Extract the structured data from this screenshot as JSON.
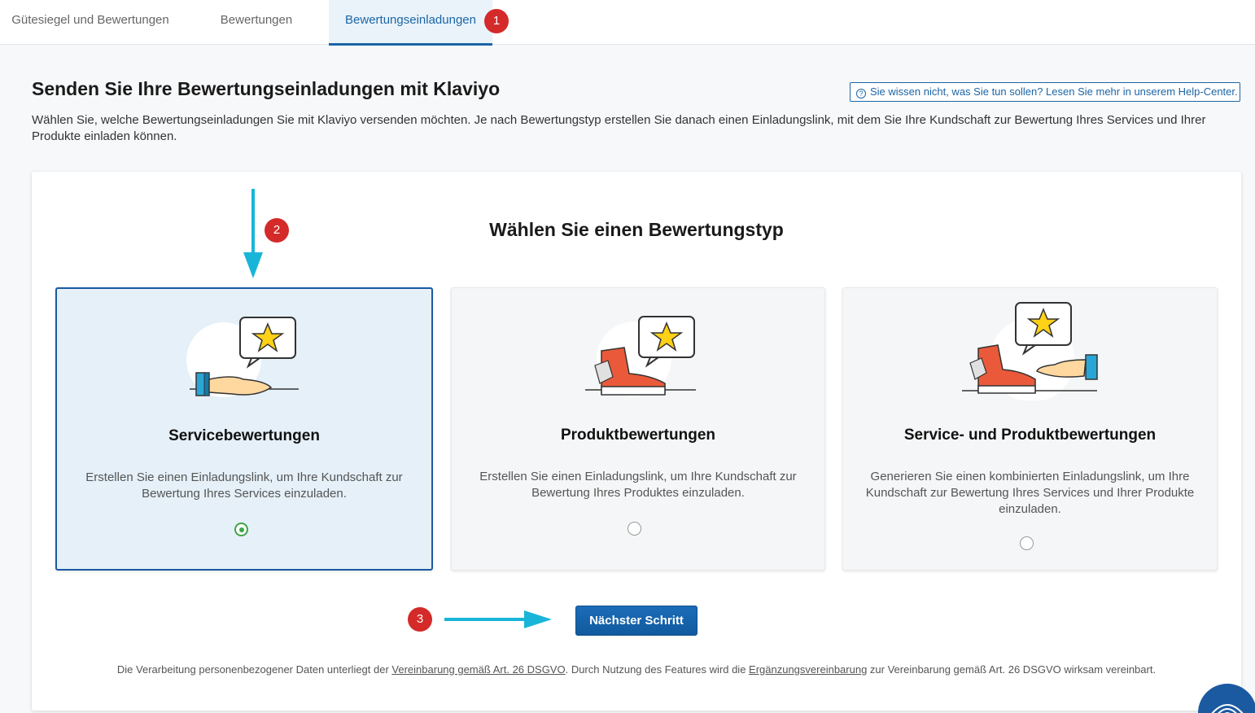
{
  "tabs": [
    {
      "label": "Gütesiegel und Bewertungen"
    },
    {
      "label": "Bewertungen"
    },
    {
      "label": "Bewertungseinladungen"
    }
  ],
  "annotations": {
    "one": "1",
    "two": "2",
    "three": "3"
  },
  "page": {
    "title": "Senden Sie Ihre Bewertungseinladungen mit Klaviyo",
    "help_link": "Sie wissen nicht, was Sie tun sollen? Lesen Sie mehr in unserem Help-Center.",
    "description": "Wählen Sie, welche Bewertungseinladungen Sie mit Klaviyo versenden möchten. Je nach Bewertungstyp erstellen Sie danach einen Einladungslink, mit dem Sie Ihre Kundschaft zur Bewertung Ihres Services und Ihrer Produkte einladen können."
  },
  "selector": {
    "title": "Wählen Sie einen Bewertungstyp",
    "cards": [
      {
        "title": "Servicebewertungen",
        "text": "Erstellen Sie einen Einladungslink, um Ihre Kundschaft zur Bewertung Ihres Services einzuladen.",
        "selected": true
      },
      {
        "title": "Produktbewertungen",
        "text": "Erstellen Sie einen Einladungslink, um Ihre Kundschaft zur Bewertung Ihres Produktes einzuladen.",
        "selected": false
      },
      {
        "title": "Service- und Produktbewertungen",
        "text": "Generieren Sie einen kombinierten Einladungslink, um Ihre Kundschaft zur Bewertung Ihres Services und Ihrer Produkte einzuladen.",
        "selected": false
      }
    ],
    "next_label": "Nächster Schritt"
  },
  "footer": {
    "part1": "Die Verarbeitung personenbezogener Daten unterliegt der ",
    "link1": "Vereinbarung gemäß Art. 26 DSGVO",
    "part2": ". Durch Nutzung des Features wird die ",
    "link2": "Ergänzungsvereinbarung",
    "part3": " zur Vereinbarung gemäß Art. 26 DSGVO wirksam vereinbart."
  },
  "colors": {
    "accent": "#1b65a6",
    "annotation_arrow": "#19b5d8",
    "badge": "#d42a2a",
    "selected_radio": "#3ea546"
  }
}
